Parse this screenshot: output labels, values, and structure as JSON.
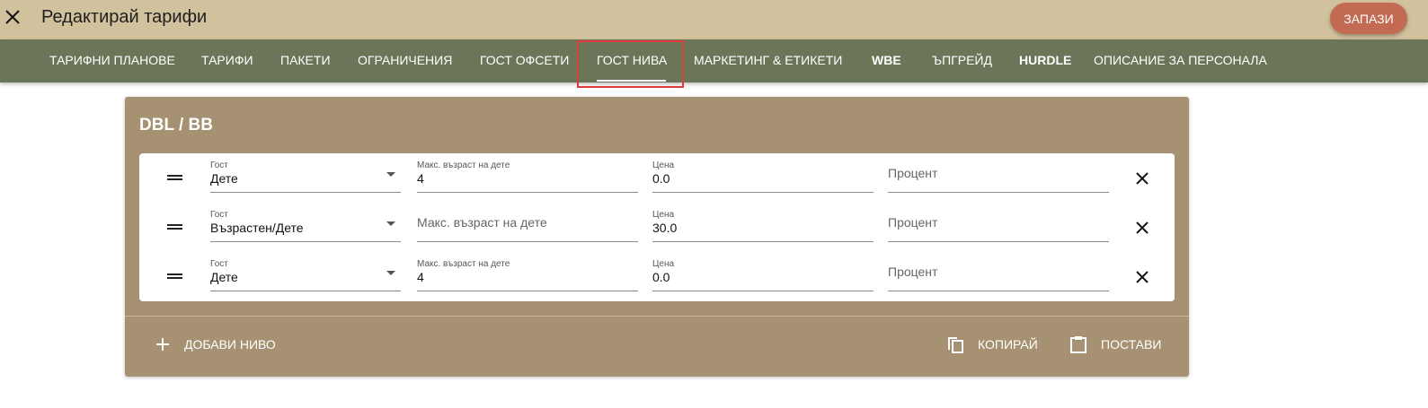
{
  "header": {
    "title": "Редактирай тарифи",
    "save_label": "ЗАПАЗИ"
  },
  "tabs": [
    {
      "label": "ТАРИФНИ ПЛАНОВЕ"
    },
    {
      "label": "ТАРИФИ"
    },
    {
      "label": "ПАКЕТИ"
    },
    {
      "label": "ОГРАНИЧЕНИЯ"
    },
    {
      "label": "ГОСТ ОФСЕТИ"
    },
    {
      "label": "ГОСТ НИВА",
      "active": true
    },
    {
      "label": "МАРКЕТИНГ & ЕТИКЕТИ"
    },
    {
      "label": "WBE"
    },
    {
      "label": "ЪПГРЕЙД"
    },
    {
      "label": "HURDLE"
    },
    {
      "label": "ОПИСАНИЕ ЗА ПЕРСОНАЛА"
    }
  ],
  "card": {
    "title": "DBL / BB",
    "labels": {
      "guest": "Гост",
      "max_child_age": "Макс. възраст на дете",
      "price": "Цена",
      "percent": "Процент"
    },
    "rows": [
      {
        "guest": "Дете",
        "max_child_age": "4",
        "price": "0.0",
        "percent": ""
      },
      {
        "guest": "Възрастен/Дете",
        "max_child_age": "",
        "price": "30.0",
        "percent": ""
      },
      {
        "guest": "Дете",
        "max_child_age": "4",
        "price": "0.0",
        "percent": ""
      }
    ],
    "add_level_label": "ДОБАВИ НИВО",
    "copy_label": "КОПИРАЙ",
    "paste_label": "ПОСТАВИ"
  },
  "icons": {
    "close": "close-icon",
    "drag": "drag-handle-icon",
    "dropdown": "caret-down-icon",
    "remove": "close-icon",
    "add": "plus-icon",
    "copy": "copy-icon",
    "paste": "clipboard-icon"
  },
  "colors": {
    "header_bg": "#d2c19d",
    "tabbar_bg": "#6b7558",
    "card_bg": "#a69272",
    "save_button": "#c26a52",
    "highlight": "#e03a3a"
  }
}
